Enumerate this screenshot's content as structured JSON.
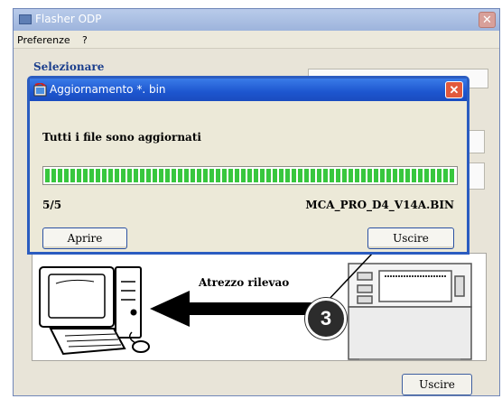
{
  "main_window": {
    "title": "Flasher ODP",
    "close_glyph": "✕",
    "menu": [
      "Preferenze",
      "?"
    ],
    "section_label": "Selezionare",
    "uscire_label": "Uscire"
  },
  "dialog": {
    "title": "Aggiornamento *. bin",
    "close_glyph": "✕",
    "status_message": "Tutti i file sono aggiornati",
    "progress_fraction": 1.0,
    "count": "5/5",
    "filename": "MCA_PRO_D4_V14A.BIN",
    "open_label": "Aprire",
    "exit_label": "Uscire"
  },
  "illustration": {
    "arrow_label": "Atrezzo rilevao",
    "callout_number": "3"
  },
  "colors": {
    "dialog_title": "#1d56cf",
    "progress_green": "#38c73e",
    "close_red": "#e2593c"
  }
}
